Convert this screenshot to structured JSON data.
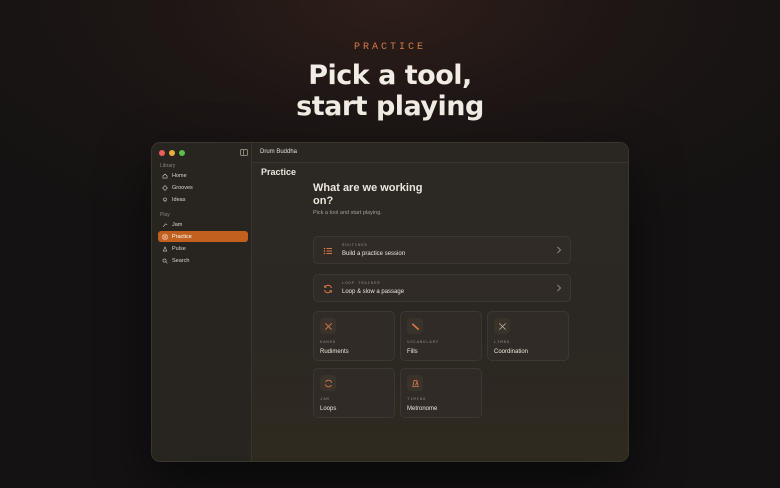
{
  "hero": {
    "eyebrow": "PRACTICE",
    "headline_line1": "Pick a tool,",
    "headline_line2": "start playing"
  },
  "window": {
    "app_title": "Drum Buddha"
  },
  "sidebar": {
    "section_library": "Library",
    "library_items": [
      {
        "label": "Home",
        "icon": "home-icon"
      },
      {
        "label": "Grooves",
        "icon": "grooves-icon"
      },
      {
        "label": "Ideas",
        "icon": "ideas-icon"
      }
    ],
    "section_play": "Play",
    "play_items": [
      {
        "label": "Jam",
        "icon": "jam-icon"
      },
      {
        "label": "Practice",
        "icon": "practice-icon",
        "active": true
      },
      {
        "label": "Pulse",
        "icon": "pulse-icon"
      },
      {
        "label": "Search",
        "icon": "search-icon"
      }
    ]
  },
  "main": {
    "page_title": "Practice",
    "question": "What are we working on?",
    "subtitle": "Pick a tool and start playing.",
    "rows": [
      {
        "tag": "ROUTINES",
        "title": "Build a practice session",
        "icon": "routines-icon"
      },
      {
        "tag": "LOOP TRAINER",
        "title": "Loop & slow a passage",
        "icon": "loop-icon"
      }
    ],
    "tiles": [
      {
        "tag": "HANDS",
        "title": "Rudiments",
        "icon": "sticks-icon"
      },
      {
        "tag": "VOCABULARY",
        "title": "Fills",
        "icon": "stick-icon"
      },
      {
        "tag": "LIMBS",
        "title": "Coordination",
        "icon": "cross-icon"
      },
      {
        "tag": "JAM",
        "title": "Loops",
        "icon": "loop-icon"
      },
      {
        "tag": "TIMING",
        "title": "Metronome",
        "icon": "metronome-icon"
      }
    ]
  },
  "colors": {
    "accent": "#c2611f",
    "eyebrow": "#d9774a"
  }
}
